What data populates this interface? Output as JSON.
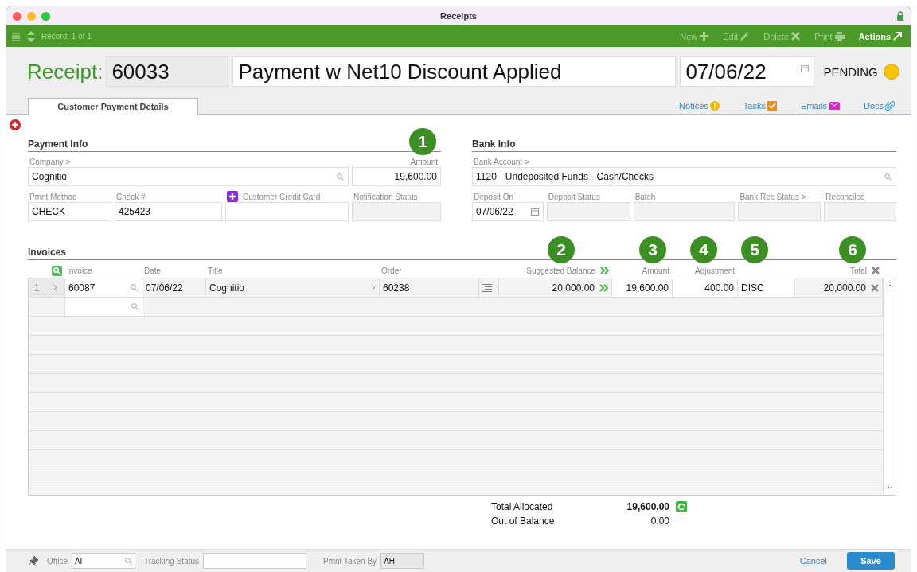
{
  "window": {
    "title": "Receipts"
  },
  "toolbar": {
    "record": "Record: 1 of 1",
    "actions": [
      {
        "label": "New",
        "kind": "new",
        "disabled": true
      },
      {
        "label": "Edit",
        "kind": "edit",
        "disabled": true
      },
      {
        "label": "Delete",
        "kind": "delete",
        "disabled": true
      },
      {
        "label": "Print",
        "kind": "print",
        "disabled": true
      },
      {
        "label": "Actions",
        "kind": "actions",
        "disabled": false
      }
    ]
  },
  "header": {
    "label": "Receipt:",
    "number": "60033",
    "title": "Payment w Net10 Discount Applied",
    "date": "07/06/22",
    "status": "PENDING"
  },
  "tabs": [
    {
      "label": "Customer Payment Details",
      "selected": true
    }
  ],
  "links": [
    {
      "label": "Notices",
      "kind": "notices"
    },
    {
      "label": "Tasks",
      "kind": "tasks"
    },
    {
      "label": "Emails",
      "kind": "emails"
    },
    {
      "label": "Docs",
      "kind": "docs"
    }
  ],
  "payment_info": {
    "title": "Payment Info",
    "rows": [
      [
        {
          "label": "Company >",
          "value": "Cognitio",
          "kind": "lookup"
        },
        {
          "label": "Amount",
          "value": "19,600.00",
          "kind": "number"
        }
      ],
      [
        {
          "label": "Pmnt Method",
          "value": "CHECK",
          "kind": "text"
        },
        {
          "label": "Check #",
          "value": "425423",
          "kind": "text"
        },
        {
          "label": "Customer Credit Card",
          "kind": "add"
        },
        {
          "label": "Notification Status",
          "kind": "readonly"
        }
      ]
    ]
  },
  "bank_info": {
    "title": "Bank Info",
    "rows": [
      [
        {
          "label": "Bank Account >",
          "code": "1120",
          "value": "Undeposited Funds - Cash/Checks",
          "kind": "account"
        }
      ],
      [
        {
          "label": "Deposit On",
          "value": "07/06/22",
          "kind": "date"
        },
        {
          "label": "Deposit Status",
          "kind": "readonly"
        },
        {
          "label": "Batch",
          "kind": "readonly"
        },
        {
          "label": "Bank Rec Status >",
          "kind": "readonly"
        },
        {
          "label": "Reconciled",
          "kind": "readonly"
        }
      ]
    ]
  },
  "invoices": {
    "title": "Invoices",
    "columns": [
      "Invoice",
      "Date",
      "Title",
      "Order",
      "Suggested Balance",
      "Amount",
      "Adjustment",
      "Total"
    ],
    "rows": [
      {
        "line": "1",
        "invoice": "60087",
        "date": "07/06/22",
        "title": "Cognitio",
        "order": "60238",
        "suggested_balance": "20,000.00",
        "amount": "19,600.00",
        "adjustment": "400.00",
        "type": "DISC",
        "total": "20,000.00"
      }
    ]
  },
  "totals": [
    {
      "label": "Total Allocated",
      "value": "19,600.00",
      "kind": "bold"
    },
    {
      "label": "Out of Balance",
      "value": "0.00",
      "kind": "plain"
    }
  ],
  "callouts": [
    "1",
    "2",
    "3",
    "4",
    "5",
    "6"
  ],
  "footer": {
    "office_label": "Office",
    "office": "AI",
    "tracking_label": "Tracking Status",
    "taken_label": "Pmnt Taken By",
    "taken": "AH",
    "cancel": "Cancel",
    "save": "Save"
  }
}
